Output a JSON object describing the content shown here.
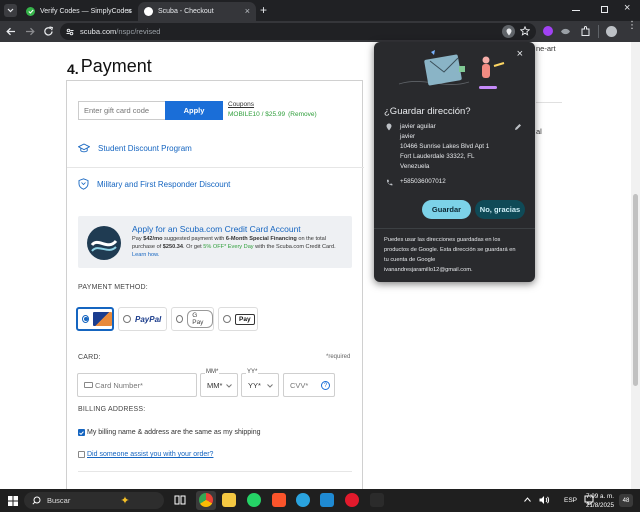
{
  "browser": {
    "tabs": [
      {
        "title": "Verify Codes — SimplyCodes",
        "active": false
      },
      {
        "title": "Scuba - Checkout",
        "active": true
      }
    ],
    "new_tab_symbol": "+",
    "url_host": "scuba.com",
    "url_path": "/nspc/revised"
  },
  "checkout": {
    "step_number": "4.",
    "step_title": "Payment",
    "gift_card": {
      "placeholder": "Enter gift card code",
      "apply_label": "Apply"
    },
    "coupons": {
      "label": "Coupons",
      "code_text": "MOBILE10 / $25.99",
      "remove_label": "(Remove)"
    },
    "links": {
      "student": "Student Discount Program",
      "military": "Military and First Responder Discount"
    },
    "credit_offer": {
      "title": "Apply for an Scuba.com Credit Card Account",
      "line1_a": "Pay ",
      "line1_amount": "$42/mo",
      "line1_b": " suggested payment with ",
      "line1_bold": "6-Month Special Financing",
      "line1_c": " on the total",
      "line2_a": "purchase of ",
      "line2_amount": "$250.34",
      "line2_b": ". Or get ",
      "line2_highlight": "5% OFF* Every Day",
      "line2_c": " with the Scuba.com Credit Card.",
      "learn_more": "Learn how."
    },
    "payment_method": {
      "label": "PAYMENT METHOD:",
      "options": [
        "Card",
        "PayPal",
        "G Pay",
        "Apple Pay"
      ],
      "selected": "Card",
      "paypal_text": "PayPal",
      "gpay_text": "G Pay",
      "applepay_text": "Pay"
    },
    "card": {
      "label": "CARD:",
      "required_note": "*required",
      "number_placeholder": "Card Number*",
      "mm_label": "MM*",
      "mm_value": "MM*",
      "yy_label": "YY*",
      "yy_value": "YY*",
      "cvv_placeholder": "CVV*",
      "help_icon": "?"
    },
    "billing": {
      "label": "BILLING ADDRESS:",
      "same_as_shipping": "My billing name & address are the same as my shipping",
      "same_checked": true,
      "assist_question": "Did someone assist you with your order?",
      "assist_checked": false
    }
  },
  "right_column": {
    "fragment_1": "ne-art",
    "fragment_2": "al"
  },
  "save_address_popup": {
    "title": "¿Guardar dirección?",
    "address_lines": [
      "javier aguilar",
      "javier",
      "10466 Sunrise Lakes Blvd Apt 1",
      "Fort Lauderdale 33322, FL",
      "Venezuela"
    ],
    "phone": "+585036007012",
    "save_label": "Guardar",
    "decline_label": "No, gracias",
    "footer": [
      "Puedes usar las direcciones guardadas en los",
      "productos de Google. Esta dirección se guardará en",
      "tu cuenta de Google",
      "ivanandresjaramillo12@gmail.com."
    ],
    "close_symbol": "×"
  },
  "taskbar": {
    "search_label": "Buscar",
    "language": "ESP",
    "time": "7:09 a. m.",
    "date": "21/8/2025",
    "notification_count": "48"
  },
  "colors": {
    "scuba_blue": "#1565c0",
    "green": "#2e9e3a",
    "popup_bg": "#292a2d",
    "popup_button_bg": "#7cd2e8",
    "popup_button_text": "#0b2733",
    "popup_secondary_bg": "#0f4a57"
  }
}
